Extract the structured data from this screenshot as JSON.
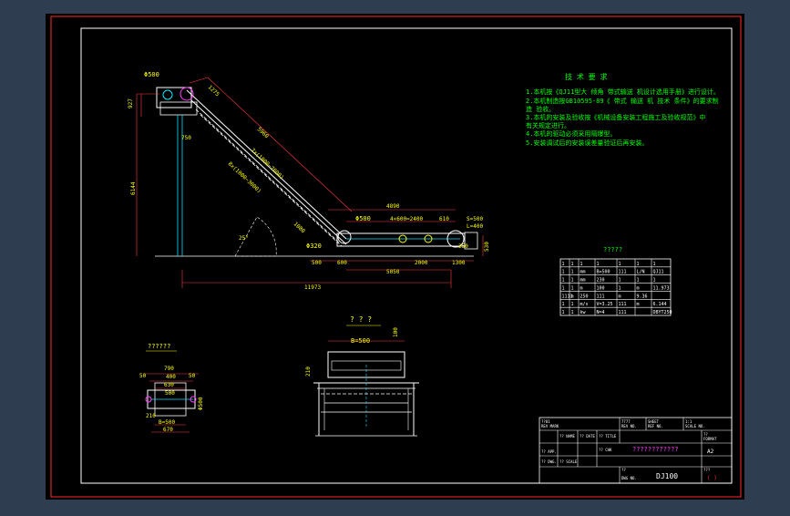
{
  "colors": {
    "background": "#2f3d51",
    "sheet": "#000000",
    "border": "#ff2a2a",
    "frame": "#ffffff",
    "note_text": "#00ff00",
    "dimension": "#ff3b3b",
    "outline": "#ffffff",
    "leader": "#00e5ff",
    "accent_yellow": "#ffff00",
    "accent_magenta": "#ff40ff"
  },
  "drawing": {
    "top_labels": {
      "head_pulley": "Φ500",
      "height_927": "927",
      "dim_1275": "1275",
      "dim_5960": "5960",
      "dim_750": "750",
      "dim_6144": "6144",
      "chain_spec": "7x(1000~7000)",
      "segment_spec": "8x(1000~3000)",
      "dim_1080": "1080",
      "angle": "25°",
      "tail_pulley": "Φ320",
      "dim_500_bottom": "500",
      "dim_600": "600",
      "dim_4890": "4890",
      "pulley_500": "Φ500",
      "spacing": "4×600=2400",
      "dim_610": "610",
      "s_500": "S=500",
      "l_400": "L=400",
      "dim_250": "250",
      "dim_2000": "2000",
      "dim_1300": "1300",
      "dim_530": "530",
      "dim_5050": "5050",
      "dim_11973": "11973"
    },
    "notes": {
      "heading": "技 术 要 求",
      "lines": [
        "1.本机按《QJ11型大 倾角 带式输送 机设计选用手册》进行设计。",
        "2.本机制造按GB10595-89《  带式 输送 机 技术 条件》的要求制",
        "  造 验收。",
        "3.本机的安装及验收按《机械设备安装工程施工及验收规范》中",
        "  有关规定进行。",
        "4.本机的驱动必须采用隔爆型。",
        "5.安装调试后的安装误差量验证后再安装。"
      ]
    },
    "param_table": {
      "title": "?????",
      "rows": [
        [
          "1",
          "1",
          "1",
          "1",
          "1",
          "1",
          "1"
        ],
        [
          "1",
          "1",
          "mm",
          "B=500",
          "111",
          "L/N",
          "QJ11"
        ],
        [
          "1",
          "1",
          "mm",
          "230",
          "1",
          "1",
          "1"
        ],
        [
          "1",
          "1",
          "m",
          "100",
          "1",
          "m",
          "11.973"
        ],
        [
          "1111",
          "m",
          "250",
          "111",
          "m",
          "9.36"
        ],
        [
          "1",
          "1",
          "m/s",
          "V=3.25",
          "111",
          "m",
          "6.144"
        ],
        [
          "1",
          "1",
          "kw",
          "N=4",
          "111",
          "",
          "DBYT250"
        ]
      ]
    },
    "section_view": {
      "title": "??????",
      "dims": {
        "d790": "790",
        "d50_left": "50",
        "d400": "400",
        "d50_right": "50",
        "d630": "630",
        "d500_top": "500",
        "dphi500": "Φ500",
        "d210": "210",
        "b500": "B=500",
        "d670": "670"
      }
    },
    "end_view": {
      "title": "? ? ?",
      "dims": {
        "b500": "B=500",
        "d100": "100",
        "d210": "210"
      }
    },
    "title_block": {
      "cells": {
        "r1a": "??01",
        "r1b": "REV MARK",
        "r1c": "7777",
        "r1d": "REV NO.",
        "r1e": "SHEET",
        "r1f": "REF NO.",
        "r1g": "1:1",
        "r1h": "SCALE NO.",
        "r2a": "?? NAME",
        "r2b": "?? DATE",
        "r2c": "?? TITLE",
        "r2d": "????????????",
        "r2e": "??",
        "r2f": "FORMAT",
        "r2g": "A2",
        "r3a": "?? APP.",
        "r3b": "?? DWG.",
        "r3c": "?? CHK",
        "r3d": "?? SCALE",
        "r4a": "??",
        "r4b": "DWG NO.",
        "r4c": "DJ100",
        "r4d": "???",
        "r4e": "( )"
      }
    }
  }
}
